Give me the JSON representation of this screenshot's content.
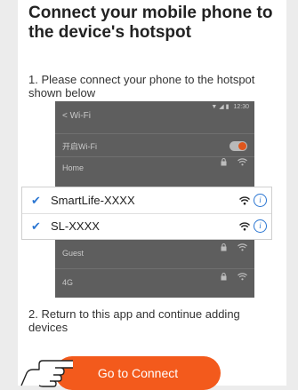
{
  "title": "Connect your mobile phone to the device's hotspot",
  "step1": "1. Please connect your phone to the hotspot shown below",
  "phone": {
    "time": "12:30",
    "header": "< Wi-Fi",
    "rows": [
      {
        "label": "开启Wi-Fi"
      },
      {
        "label": "Home"
      },
      {
        "label": "Guest"
      },
      {
        "label": "4G"
      }
    ],
    "wifi_toggle_on": true
  },
  "networks": [
    {
      "check": "✔",
      "name": "SmartLife-XXXX"
    },
    {
      "check": "✔",
      "name": "SL-XXXX"
    }
  ],
  "step2": "2. Return to this app and continue adding devices",
  "connect_button": "Go to Connect",
  "colors": {
    "accent": "#f35a1c",
    "link": "#2b76d2"
  },
  "icons": [
    "wifi-icon",
    "lock-icon",
    "info-icon",
    "check-icon",
    "hand-pointer-icon"
  ]
}
